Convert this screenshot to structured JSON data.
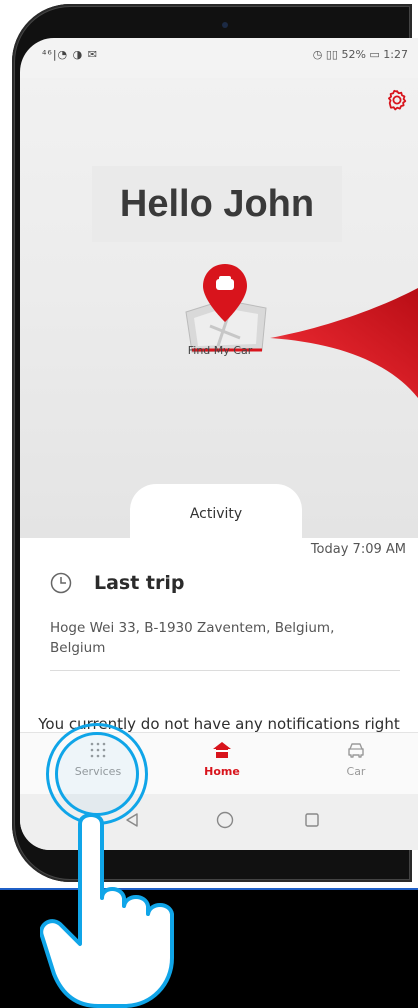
{
  "status_bar": {
    "left_icons": "⁴⁶|◔ ◑ ✉",
    "right_text": "◷ ▯▯ 52% ▭ 1:27"
  },
  "header": {
    "greeting": "Hello John",
    "settings_icon": "gear-icon"
  },
  "find_my_car": {
    "label": "Find My Car",
    "icon": "map-pin-car-icon"
  },
  "activity_tab": {
    "label": "Activity"
  },
  "activity": {
    "timestamp": "Today 7:09 AM",
    "last_trip_title": "Last trip",
    "last_trip_address": "Hoge Wei 33, B-1930 Zaventem, Belgium, Belgium",
    "notification_text": "You currently do not have any notifications right now"
  },
  "bottom_nav": {
    "items": [
      {
        "label": "Services",
        "icon": "grid-dots-icon"
      },
      {
        "label": "Home",
        "icon": "home-icon",
        "active": true
      },
      {
        "label": "Car",
        "icon": "car-icon"
      }
    ]
  },
  "colors": {
    "accent": "#d8141c",
    "tap_indicator": "#10a5e8"
  }
}
